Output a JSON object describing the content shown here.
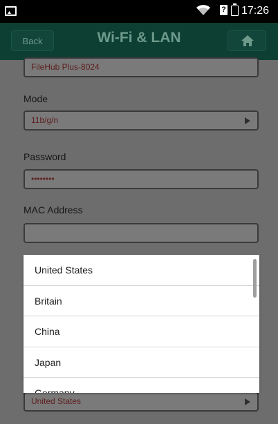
{
  "status_bar": {
    "time": "17:26",
    "sim_label": "?"
  },
  "app_bar": {
    "back_label": "Back",
    "title": "Wi-Fi & LAN",
    "home_icon": "home-icon"
  },
  "form": {
    "ssid_value": "FileHub Plus-8024",
    "mode_label": "Mode",
    "mode_value": "11b/g/n",
    "password_label": "Password",
    "password_value": "••••••••",
    "mac_label": "MAC Address",
    "region_value": "United States"
  },
  "region_dialog": {
    "options": [
      "United States",
      "Britain",
      "China",
      "Japan",
      "Germany"
    ]
  },
  "colors": {
    "app_bar": "#0d3f33",
    "overlay": "#6d6d6d",
    "value_text": "#5e1e1e"
  }
}
